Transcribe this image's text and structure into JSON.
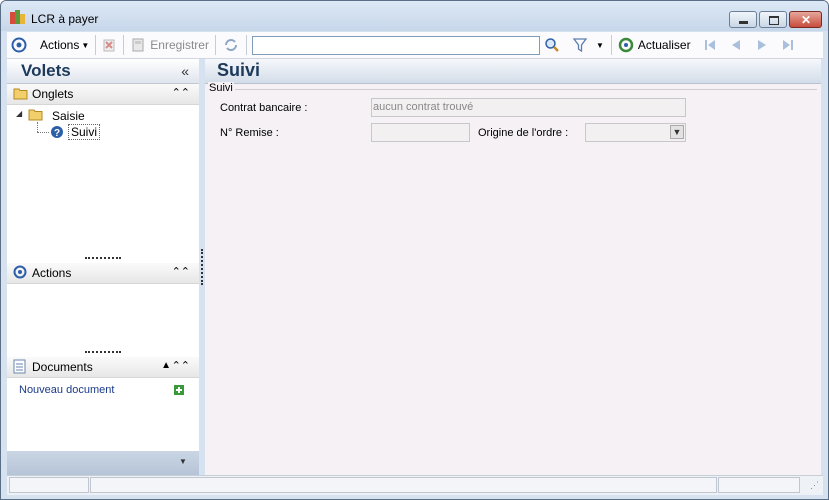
{
  "window": {
    "title": "LCR à payer"
  },
  "toolbar": {
    "actions_label": "Actions",
    "save_label": "Enregistrer",
    "search_value": "",
    "refresh_label": "Actualiser"
  },
  "left_panel": {
    "title": "Volets",
    "onglets": {
      "label": "Onglets",
      "tree": [
        {
          "label": "Saisie",
          "children": [
            {
              "label": "Suivi"
            }
          ]
        }
      ]
    },
    "actions": {
      "label": "Actions"
    },
    "documents": {
      "label": "Documents",
      "new_document_label": "Nouveau document"
    }
  },
  "main": {
    "title": "Suivi",
    "group_label": "Suivi",
    "contrat_bancaire_label": "Contrat bancaire :",
    "contrat_bancaire_value": "aucun contrat trouvé",
    "remise_label": "N° Remise :",
    "remise_value": "",
    "origine_label": "Origine de l'ordre :",
    "origine_value": ""
  },
  "colors": {
    "title_blue": "#1d3a5a",
    "close_red": "#c84c3c",
    "link_blue": "#1a3a8a"
  }
}
